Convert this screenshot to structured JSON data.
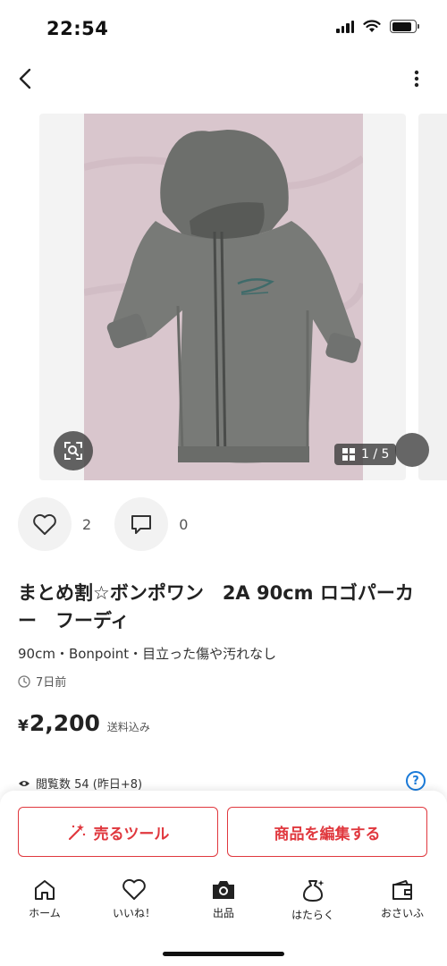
{
  "status_bar": {
    "time": "22:54",
    "battery_level": 0.85
  },
  "nav": {
    "back_icon": "chevron-left-icon",
    "more_icon": "vertical-ellipsis-icon"
  },
  "carousel": {
    "counter": "1 / 5",
    "zoom_icon": "image-search-icon",
    "grid_icon": "grid-icon",
    "photo_description_icon": "gray-hoodie-photo"
  },
  "actions": {
    "likes": "2",
    "comments": "0"
  },
  "item": {
    "title": "まとめ割☆ボンポワン　2A 90cm ロゴパーカー　フーディ",
    "meta": "90cm・Bonpoint・目立った傷や汚れなし",
    "posted": "7日前",
    "price_yen": "¥",
    "price": "2,200",
    "price_note": "送料込み",
    "views": "閲覧数  54 (昨日+8)",
    "help": "?"
  },
  "buttons": {
    "sell_tool": "売るツール",
    "edit_item": "商品を編集する"
  },
  "tabbar": [
    {
      "label": "ホーム",
      "icon": "home-icon"
    },
    {
      "label": "いいね！",
      "icon": "heart-icon"
    },
    {
      "label": "出品",
      "icon": "camera-icon"
    },
    {
      "label": "はたらく",
      "icon": "money-bag-icon"
    },
    {
      "label": "おさいふ",
      "icon": "wallet-icon"
    }
  ],
  "colors": {
    "accent": "#e0383e",
    "help_blue": "#1a7ad9"
  }
}
